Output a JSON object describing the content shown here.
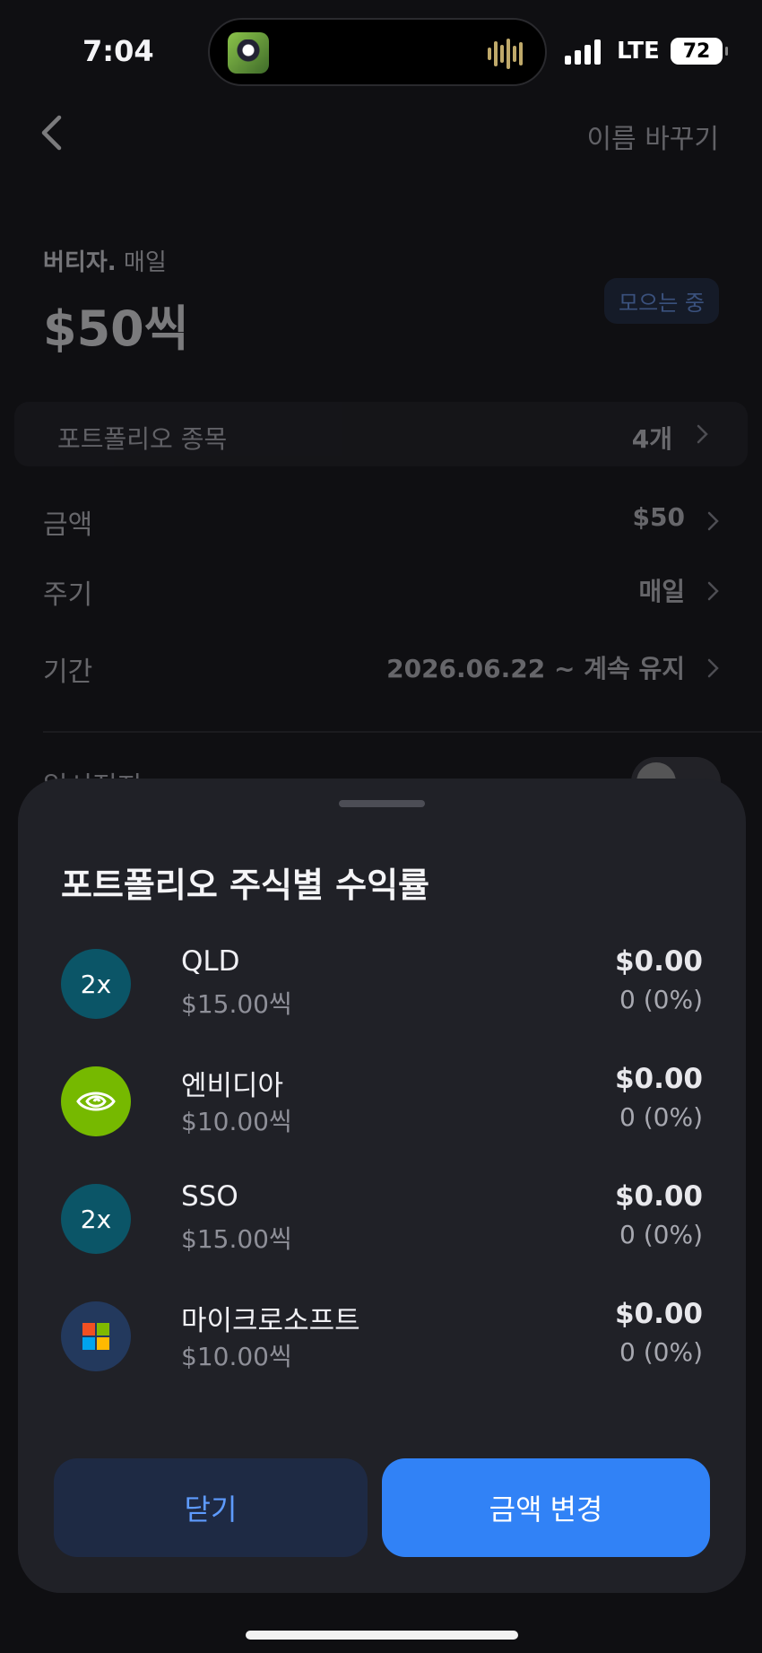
{
  "status_bar": {
    "time": "7:04",
    "network": "LTE",
    "battery": "72"
  },
  "header": {
    "rename_label": "이름 바꾸기"
  },
  "plan": {
    "label_bold": "버티자.",
    "label_freq": "매일",
    "amount": "$50씩",
    "status_badge": "모으는 중"
  },
  "portfolio_row": {
    "label": "포트폴리오 종목",
    "value": "4개"
  },
  "settings": [
    {
      "label": "금액",
      "value": "$50"
    },
    {
      "label": "주기",
      "value": "매일"
    },
    {
      "label": "기간",
      "value": "2026.06.22 ~ 계속 유지"
    }
  ],
  "hidden_row_label": "일시정지",
  "sheet": {
    "title": "포트폴리오 주식별 수익률",
    "stocks": [
      {
        "logo": "2x",
        "logo_color": "#0b5567",
        "name": "QLD",
        "each": "$15.00씩",
        "pl": "$0.00",
        "pct": "0 (0%)"
      },
      {
        "logo": "nvidia-icon",
        "logo_color": "#76b900",
        "name": "엔비디아",
        "each": "$10.00씩",
        "pl": "$0.00",
        "pct": "0 (0%)"
      },
      {
        "logo": "2x",
        "logo_color": "#0b5567",
        "name": "SSO",
        "each": "$15.00씩",
        "pl": "$0.00",
        "pct": "0 (0%)"
      },
      {
        "logo": "microsoft-icon",
        "logo_color": "#23395d",
        "name": "마이크로소프트",
        "each": "$10.00씩",
        "pl": "$0.00",
        "pct": "0 (0%)"
      }
    ],
    "close_label": "닫기",
    "change_label": "금액 변경"
  }
}
